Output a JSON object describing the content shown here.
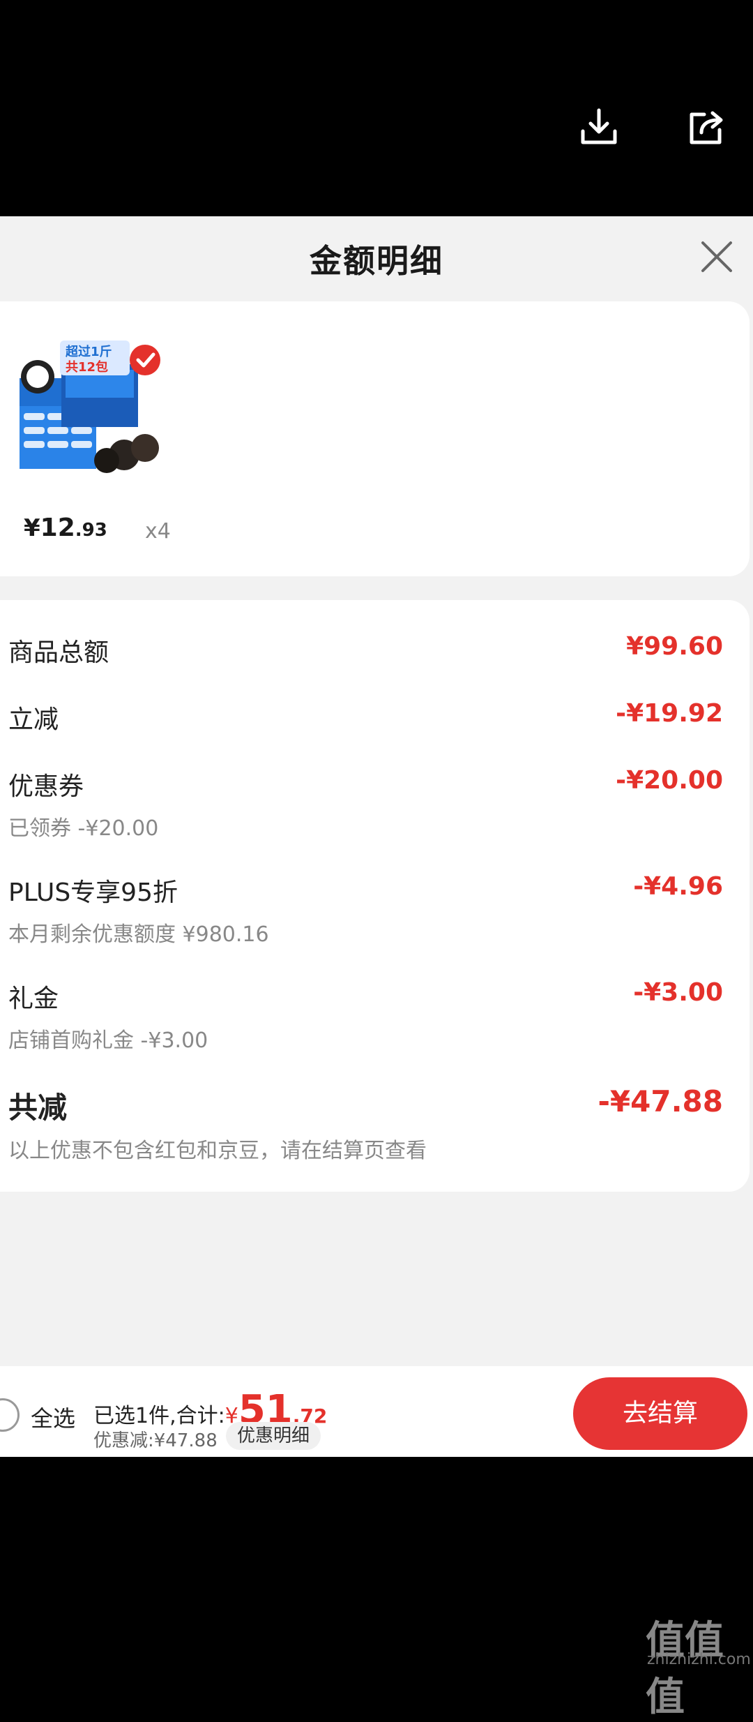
{
  "top_bar": {
    "icons": [
      "download-icon",
      "share-icon"
    ]
  },
  "sheet": {
    "title": "金额明细",
    "close_icon": "close-icon"
  },
  "product": {
    "price_symbol": "¥",
    "price_int": "12",
    "price_dec": ".93",
    "quantity": "x4"
  },
  "details": [
    {
      "label": "商品总额",
      "amount": "¥99.60"
    },
    {
      "label": "立减",
      "amount": "-¥19.92"
    },
    {
      "label": "优惠券",
      "sub": "已领券 -¥20.00",
      "amount": "-¥20.00"
    },
    {
      "label": "PLUS专享95折",
      "sub": "本月剩余优惠额度 ¥980.16",
      "amount": "-¥4.96"
    },
    {
      "label": "礼金",
      "sub": "店铺首购礼金 -¥3.00",
      "amount": "-¥3.00"
    },
    {
      "label": "共减",
      "sub": "以上优惠不包含红包和京豆，请在结算页查看",
      "amount": "-¥47.88"
    }
  ],
  "footer": {
    "select_all": "全选",
    "selected_text": "已选1件,合计:",
    "total_symbol": "¥",
    "total_int": "51",
    "total_dec": ".72",
    "discount_text": "优惠减:¥47.88",
    "detail_chip": "优惠明细",
    "checkout": "去结算"
  },
  "watermark": {
    "text": "值值值",
    "sub": "zhizhizhi.com"
  },
  "colors": {
    "accent": "#e4312b",
    "checkout_bg": "#e63434"
  }
}
